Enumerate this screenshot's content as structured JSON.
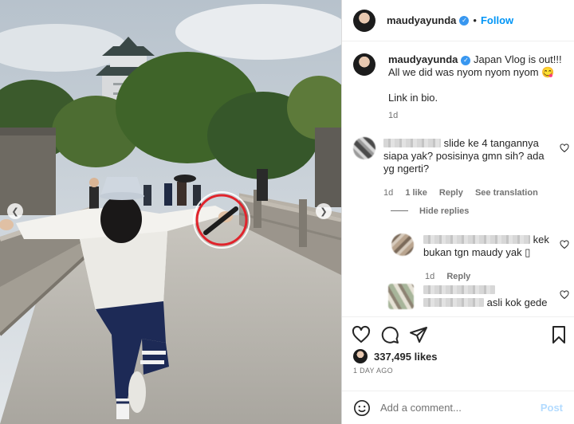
{
  "post": {
    "username": "maudyayunda",
    "follow_label": "Follow",
    "dot": "•",
    "caption_lines": [
      "Japan Vlog is out!!!",
      "All we did was nyom nyom nyom 😋",
      "Link in bio."
    ],
    "caption_age": "1d",
    "likes": "337,495 likes",
    "posted": "1 DAY AGO"
  },
  "comments": [
    {
      "text": "slide ke 4 tangannya siapa yak? posisinya gmn sih? ada yg ngerti?",
      "age": "1d",
      "likes": "1 like",
      "reply_label": "Reply",
      "translate_label": "See translation"
    }
  ],
  "hide_replies_label": "Hide replies",
  "replies": [
    {
      "text_tail": "kek",
      "text_line2": "bukan tgn maudy yak ▯",
      "age": "1d",
      "reply_label": "Reply"
    },
    {
      "text_line2": "asli kok gede"
    }
  ],
  "add_comment": {
    "placeholder": "Add a comment...",
    "post_label": "Post"
  },
  "icons": {
    "verified": "verified-badge-icon",
    "heart": "heart-icon",
    "comment": "comment-icon",
    "share": "share-icon",
    "save": "bookmark-icon",
    "emoji": "emoji-icon",
    "prev": "chevron-left-icon",
    "next": "chevron-right-icon"
  },
  "colors": {
    "accent": "#0095f6",
    "verified": "#3897f0",
    "highlight_circle": "#e0242c"
  }
}
